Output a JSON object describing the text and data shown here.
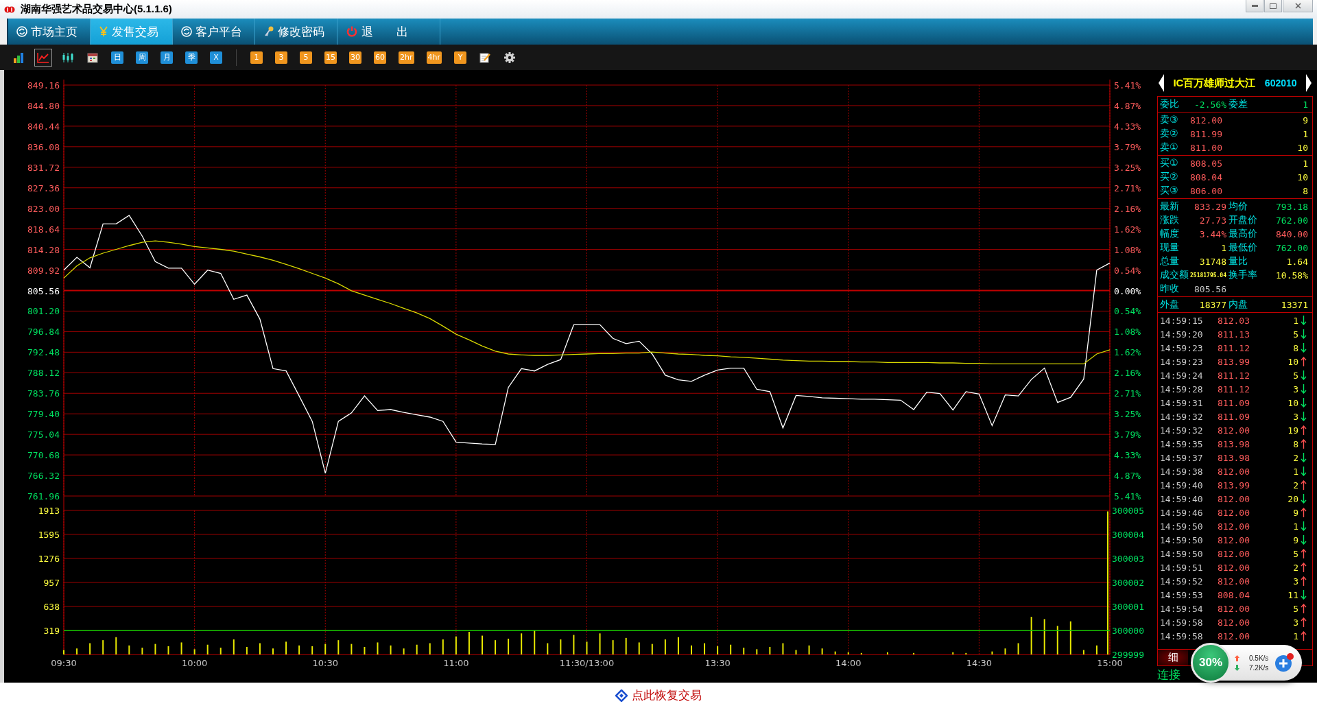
{
  "window": {
    "title": "湖南华强艺术品交易中心(5.1.1.6)"
  },
  "menu": [
    {
      "label": "市场主页",
      "kind": "refresh",
      "selected": false
    },
    {
      "label": "发售交易",
      "kind": "yen",
      "selected": true
    },
    {
      "label": "客户平台",
      "kind": "refresh",
      "selected": false
    },
    {
      "label": "修改密码",
      "kind": "key",
      "selected": false
    },
    {
      "label": "退　　出",
      "kind": "power",
      "selected": false
    }
  ],
  "toolbar": {
    "tools": [
      {
        "kind": "bar-chart",
        "selected": false
      },
      {
        "kind": "line-chart",
        "selected": true
      },
      {
        "kind": "candlestick",
        "selected": false
      },
      {
        "kind": "calendar",
        "selected": false
      }
    ],
    "periods": [
      "日",
      "周",
      "月",
      "季",
      "X"
    ],
    "intervals": [
      "1",
      "3",
      "5",
      "15",
      "30",
      "60",
      "2hr",
      "4hr",
      "Y"
    ],
    "end_tools": [
      {
        "kind": "note"
      },
      {
        "kind": "settings"
      }
    ]
  },
  "price_chart": {
    "percent_labels": [
      {
        "text": "5.41%",
        "color": "#ff5c5c"
      },
      {
        "text": "4.87%",
        "color": "#ff5c5c"
      },
      {
        "text": "4.33%",
        "color": "#ff5c5c"
      },
      {
        "text": "3.79%",
        "color": "#ff5c5c"
      },
      {
        "text": "3.25%",
        "color": "#ff5c5c"
      },
      {
        "text": "2.71%",
        "color": "#ff5c5c"
      },
      {
        "text": "2.16%",
        "color": "#ff5c5c"
      },
      {
        "text": "1.62%",
        "color": "#ff5c5c"
      },
      {
        "text": "1.08%",
        "color": "#ff5c5c"
      },
      {
        "text": "0.54%",
        "color": "#ff5c5c"
      },
      {
        "text": "0.00%",
        "color": "#ffffff"
      },
      {
        "text": "0.54%",
        "color": "#00e060"
      },
      {
        "text": "1.08%",
        "color": "#00e060"
      },
      {
        "text": "1.62%",
        "color": "#00e060"
      },
      {
        "text": "2.16%",
        "color": "#00e060"
      },
      {
        "text": "2.71%",
        "color": "#00e060"
      },
      {
        "text": "3.25%",
        "color": "#00e060"
      },
      {
        "text": "3.79%",
        "color": "#00e060"
      },
      {
        "text": "4.33%",
        "color": "#00e060"
      },
      {
        "text": "4.87%",
        "color": "#00e060"
      },
      {
        "text": "5.41%",
        "color": "#00e060"
      }
    ],
    "chart_data": {
      "type": "line",
      "grid": true,
      "categories": [
        null,
        null,
        null,
        null,
        null,
        null,
        null,
        null,
        null,
        null,
        null,
        null,
        null,
        null,
        null,
        null,
        null,
        null,
        null,
        null,
        null,
        null,
        null,
        null,
        null,
        null,
        null,
        null,
        null,
        null,
        null,
        null,
        null,
        null,
        null,
        null,
        null,
        null,
        null,
        null,
        null,
        null,
        null,
        null,
        null,
        null,
        null,
        null,
        null,
        null,
        null,
        null,
        null,
        null,
        null,
        null,
        null,
        null,
        null,
        null,
        null,
        null,
        null,
        null,
        null,
        null,
        null,
        null,
        null,
        null,
        null,
        null,
        null,
        null,
        null,
        null,
        null,
        null,
        null,
        null,
        null
      ],
      "series": [
        {
          "color": "#ffffff",
          "values": [
            809.9,
            812.6,
            810.4,
            819.7,
            819.7,
            821.5,
            817.1,
            811.7,
            810.3,
            810.3,
            806.9,
            809.9,
            809.2,
            803.7,
            804.6,
            799.5,
            789.0,
            788.5,
            783.2,
            777.8,
            766.8,
            777.8,
            779.6,
            783.2,
            780.1,
            780.3,
            779.7,
            779.2,
            778.7,
            777.8,
            773.4,
            773.2,
            773.0,
            772.9,
            785.0,
            789.0,
            788.5,
            789.9,
            790.9,
            798.3,
            798.3,
            798.3,
            795.4,
            794.3,
            794.8,
            792.1,
            787.6,
            786.6,
            786.3,
            787.6,
            788.7,
            789.1,
            789.1,
            784.6,
            784.1,
            776.4,
            783.3,
            783.1,
            782.8,
            782.7,
            782.6,
            782.5,
            782.5,
            782.4,
            782.3,
            780.3,
            784.0,
            783.7,
            780.2,
            784.1,
            783.6,
            776.9,
            783.4,
            783.2,
            786.7,
            789.1,
            781.8,
            782.9,
            786.8,
            809.9,
            811.4
          ]
        },
        {
          "color": "#d8d800",
          "values": [
            808.2,
            810.8,
            812.5,
            813.5,
            814.3,
            815.1,
            815.8,
            816.1,
            815.8,
            815.4,
            814.9,
            814.6,
            814.3,
            813.9,
            813.3,
            812.7,
            812.0,
            811.1,
            810.2,
            809.2,
            808.2,
            807.0,
            805.5,
            804.6,
            803.7,
            802.8,
            801.8,
            800.8,
            799.6,
            798.0,
            796.3,
            795.1,
            793.8,
            792.7,
            792.1,
            791.9,
            791.8,
            791.8,
            791.9,
            792.0,
            792.1,
            792.2,
            792.2,
            792.3,
            792.3,
            792.5,
            792.3,
            792.1,
            792.0,
            791.8,
            791.7,
            791.5,
            791.4,
            791.2,
            791.0,
            790.8,
            790.7,
            790.6,
            790.6,
            790.5,
            790.5,
            790.4,
            790.4,
            790.3,
            790.3,
            790.3,
            790.3,
            790.2,
            790.2,
            790.1,
            790.1,
            790.0,
            790.0,
            790.0,
            790.0,
            790.0,
            790.0,
            790.0,
            790.0,
            792.1,
            793.0
          ]
        }
      ],
      "ylim": [
        761.96,
        849.16
      ],
      "yticks": [
        {
          "value": 849.16,
          "label": "849.16"
        },
        {
          "value": 844.8,
          "label": "844.80"
        },
        {
          "value": 840.44,
          "label": "840.44"
        },
        {
          "value": 836.08,
          "label": "836.08"
        },
        {
          "value": 831.72,
          "label": "831.72"
        },
        {
          "value": 827.36,
          "label": "827.36"
        },
        {
          "value": 823,
          "label": "823.00"
        },
        {
          "value": 818.64,
          "label": "818.64"
        },
        {
          "value": 814.28,
          "label": "814.28"
        },
        {
          "value": 809.92,
          "label": "809.92"
        },
        {
          "value": 805.56,
          "label": "805.56"
        },
        {
          "value": 801.2,
          "label": "801.20"
        },
        {
          "value": 796.84,
          "label": "796.84"
        },
        {
          "value": 792.48,
          "label": "792.48"
        },
        {
          "value": 788.12,
          "label": "788.12"
        },
        {
          "value": 783.76,
          "label": "783.76"
        },
        {
          "value": 779.4,
          "label": "779.40"
        },
        {
          "value": 775.04,
          "label": "775.04"
        },
        {
          "value": 770.68,
          "label": "770.68"
        },
        {
          "value": 766.32,
          "label": "766.32"
        },
        {
          "value": 761.96,
          "label": "761.96"
        }
      ],
      "ref_lines": [
        {
          "axis": "y",
          "value": 805.56
        }
      ]
    }
  },
  "volume_chart": {
    "right_labels": [
      "300005",
      "300004",
      "300003",
      "300002",
      "300001",
      "300000",
      "299999"
    ],
    "chart_data": {
      "type": "bar",
      "grid": true,
      "categories": [
        "09:30",
        null,
        null,
        null,
        null,
        null,
        null,
        null,
        null,
        null,
        "10:00",
        null,
        null,
        null,
        null,
        null,
        null,
        null,
        null,
        null,
        "10:30",
        null,
        null,
        null,
        null,
        null,
        null,
        null,
        null,
        null,
        "11:00",
        null,
        null,
        null,
        null,
        null,
        null,
        null,
        null,
        null,
        "11:30/13:00",
        null,
        null,
        null,
        null,
        null,
        null,
        null,
        null,
        null,
        "13:30",
        null,
        null,
        null,
        null,
        null,
        null,
        null,
        null,
        null,
        "14:00",
        null,
        null,
        null,
        null,
        null,
        null,
        null,
        null,
        null,
        "14:30",
        null,
        null,
        null,
        null,
        null,
        null,
        null,
        null,
        null,
        "15:00"
      ],
      "series": [
        {
          "color": "#e8e800",
          "values": [
            60,
            80,
            150,
            190,
            230,
            120,
            90,
            140,
            110,
            160,
            70,
            130,
            90,
            200,
            100,
            150,
            80,
            170,
            120,
            110,
            140,
            190,
            140,
            100,
            160,
            120,
            80,
            130,
            150,
            200,
            240,
            300,
            250,
            190,
            210,
            280,
            320,
            150,
            200,
            260,
            170,
            280,
            190,
            220,
            160,
            140,
            200,
            230,
            120,
            150,
            110,
            130,
            90,
            70,
            100,
            150,
            60,
            120,
            80,
            40,
            30,
            20,
            0,
            30,
            0,
            20,
            0,
            0,
            30,
            20,
            0,
            40,
            80,
            150,
            500,
            470,
            380,
            440,
            60,
            120,
            1900
          ]
        }
      ],
      "ylim": [
        0,
        1913
      ],
      "yticks": [
        {
          "value": 1913,
          "label": "1913"
        },
        {
          "value": 1595,
          "label": "1595"
        },
        {
          "value": 1276,
          "label": "1276"
        },
        {
          "value": 957,
          "label": "957"
        },
        {
          "value": 638,
          "label": "638"
        },
        {
          "value": 319,
          "label": "319"
        }
      ],
      "ref_lines": [
        {
          "axis": "y",
          "value": 319
        }
      ]
    }
  },
  "quote": {
    "name": "IC百万雄师过大江",
    "code": "602010",
    "ratio_row": {
      "items": [
        {
          "label": "委比",
          "value": "-2.56%",
          "color": "#00e060"
        },
        {
          "label": "委差",
          "value": "1",
          "color": "#00e060"
        }
      ]
    },
    "asks": [
      {
        "label": "卖③",
        "price": "812.00",
        "qty": "9"
      },
      {
        "label": "卖②",
        "price": "811.99",
        "qty": "1"
      },
      {
        "label": "卖①",
        "price": "811.00",
        "qty": "10"
      }
    ],
    "bids": [
      {
        "label": "买①",
        "price": "808.05",
        "qty": "1"
      },
      {
        "label": "买②",
        "price": "808.04",
        "qty": "10"
      },
      {
        "label": "买③",
        "price": "806.00",
        "qty": "8"
      }
    ],
    "stats": [
      {
        "items": [
          {
            "label": "最新",
            "value": "833.29",
            "color": "#ff5c5c"
          },
          {
            "label": "均价",
            "value": "793.18",
            "color": "#00e060"
          }
        ]
      },
      {
        "items": [
          {
            "label": "涨跌",
            "value": "27.73",
            "color": "#ff5c5c"
          },
          {
            "label": "开盘价",
            "value": "762.00",
            "color": "#00e060"
          }
        ]
      },
      {
        "items": [
          {
            "label": "幅度",
            "value": "3.44%",
            "color": "#ff5c5c"
          },
          {
            "label": "最高价",
            "value": "840.00",
            "color": "#ff5c5c"
          }
        ]
      },
      {
        "items": [
          {
            "label": "现量",
            "value": "1",
            "color": "#ffff40"
          },
          {
            "label": "最低价",
            "value": "762.00",
            "color": "#00e060"
          }
        ]
      },
      {
        "items": [
          {
            "label": "总量",
            "value": "31748",
            "color": "#ffff40"
          },
          {
            "label": "量比",
            "value": "1.64",
            "color": "#ffff40"
          }
        ]
      },
      {
        "items": [
          {
            "label": "成交额",
            "value": "25181795.04",
            "color": "#ffff40"
          },
          {
            "label": "换手率",
            "value": "10.58%",
            "color": "#ffff40"
          }
        ]
      },
      {
        "items": [
          {
            "label": "昨收",
            "value": "805.56",
            "color": "#c8c8c8"
          }
        ]
      }
    ],
    "outer_inner": {
      "items": [
        {
          "label": "外盘",
          "value": "18377",
          "color": "#ffff40"
        },
        {
          "label": "内盘",
          "value": "13371",
          "color": "#ffff40"
        }
      ]
    },
    "trades": [
      {
        "time": "14:59:15",
        "price": "812.03",
        "qty": "1",
        "kind": "down"
      },
      {
        "time": "14:59:20",
        "price": "811.13",
        "qty": "5",
        "kind": "down"
      },
      {
        "time": "14:59:23",
        "price": "811.12",
        "qty": "8",
        "kind": "down"
      },
      {
        "time": "14:59:23",
        "price": "813.99",
        "qty": "10",
        "kind": "up"
      },
      {
        "time": "14:59:24",
        "price": "811.12",
        "qty": "5",
        "kind": "down"
      },
      {
        "time": "14:59:28",
        "price": "811.12",
        "qty": "3",
        "kind": "down"
      },
      {
        "time": "14:59:31",
        "price": "811.09",
        "qty": "10",
        "kind": "down"
      },
      {
        "time": "14:59:32",
        "price": "811.09",
        "qty": "3",
        "kind": "down"
      },
      {
        "time": "14:59:32",
        "price": "812.00",
        "qty": "19",
        "kind": "up"
      },
      {
        "time": "14:59:35",
        "price": "813.98",
        "qty": "8",
        "kind": "up"
      },
      {
        "time": "14:59:37",
        "price": "813.98",
        "qty": "2",
        "kind": "down"
      },
      {
        "time": "14:59:38",
        "price": "812.00",
        "qty": "1",
        "kind": "down"
      },
      {
        "time": "14:59:40",
        "price": "813.99",
        "qty": "2",
        "kind": "up"
      },
      {
        "time": "14:59:40",
        "price": "812.00",
        "qty": "20",
        "kind": "down"
      },
      {
        "time": "14:59:46",
        "price": "812.00",
        "qty": "9",
        "kind": "up"
      },
      {
        "time": "14:59:50",
        "price": "812.00",
        "qty": "1",
        "kind": "down"
      },
      {
        "time": "14:59:50",
        "price": "812.00",
        "qty": "9",
        "kind": "down"
      },
      {
        "time": "14:59:50",
        "price": "812.00",
        "qty": "5",
        "kind": "up"
      },
      {
        "time": "14:59:51",
        "price": "812.00",
        "qty": "2",
        "kind": "up"
      },
      {
        "time": "14:59:52",
        "price": "812.00",
        "qty": "3",
        "kind": "up"
      },
      {
        "time": "14:59:53",
        "price": "808.04",
        "qty": "11",
        "kind": "down"
      },
      {
        "time": "14:59:54",
        "price": "812.00",
        "qty": "5",
        "kind": "up"
      },
      {
        "time": "14:59:58",
        "price": "812.00",
        "qty": "3",
        "kind": "up"
      },
      {
        "time": "14:59:58",
        "price": "812.00",
        "qty": "1",
        "kind": "up"
      }
    ],
    "tabs": [
      {
        "label": "细",
        "selected": true
      }
    ],
    "status": "连接"
  },
  "net_monitor": {
    "percent": "30%",
    "upload": "0.5K/s",
    "download": "7.2K/s"
  },
  "footer": {
    "link": "点此恢复交易"
  }
}
